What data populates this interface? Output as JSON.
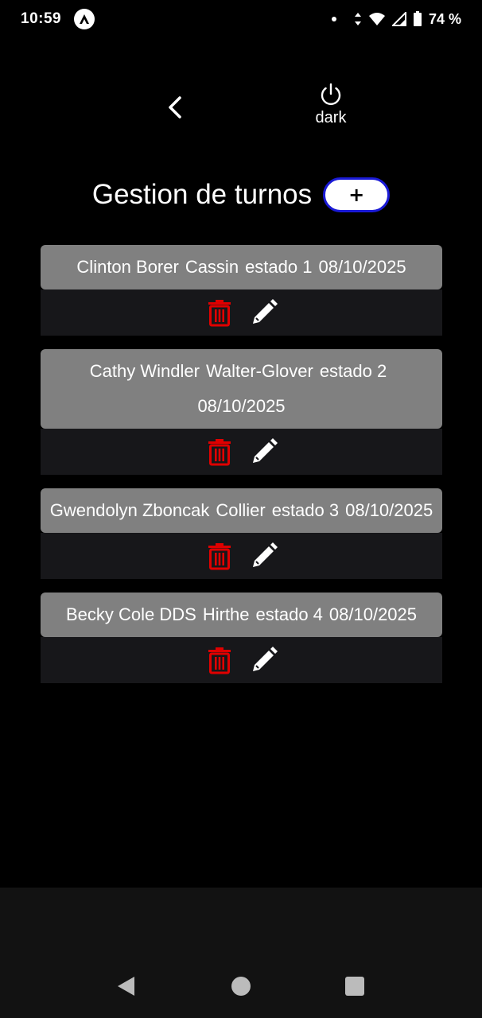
{
  "status_bar": {
    "time": "10:59",
    "battery": "74 %",
    "icons": [
      "notification-dot-icon",
      "data-arrows-icon",
      "wifi-icon",
      "signal-icon",
      "battery-icon"
    ]
  },
  "header": {
    "theme_label": "dark",
    "title": "Gestion de turnos",
    "add_label": "+"
  },
  "turns": [
    {
      "name": "Clinton Borer",
      "company": "Cassin",
      "status": "estado 1",
      "date": "08/10/2025"
    },
    {
      "name": "Cathy Windler",
      "company": "Walter-Glover",
      "status": "estado 2",
      "date": "08/10/2025"
    },
    {
      "name": "Gwendolyn Zboncak",
      "company": "Collier",
      "status": "estado 3",
      "date": "08/10/2025"
    },
    {
      "name": "Becky Cole DDS",
      "company": "Hirthe",
      "status": "estado 4",
      "date": "08/10/2025"
    }
  ],
  "colors": {
    "background": "#000000",
    "card": "#808080",
    "actions_bg": "#17171a",
    "delete": "#e00000",
    "edit": "#ffffff",
    "add_border": "#1a1ad6"
  }
}
